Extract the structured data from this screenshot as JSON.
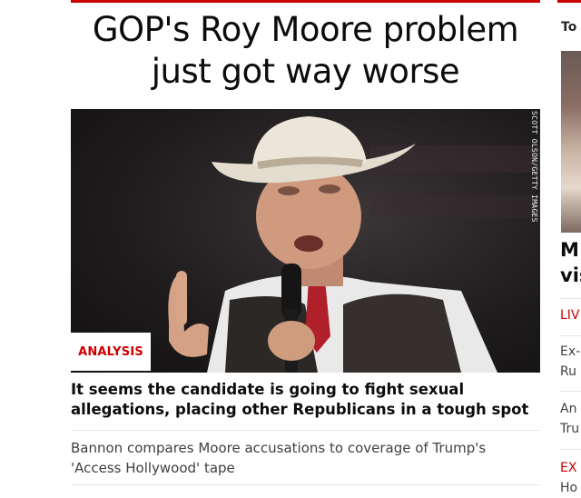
{
  "main": {
    "headline_line1": "GOP's Roy Moore problem",
    "headline_line2": "just got way worse",
    "photo_credit": "SCOTT OLSON/GETTY IMAGES",
    "badge": "ANALYSIS",
    "summary_line1": "It seems the candidate is going to fight sexual",
    "summary_line2": "allegations, placing other Republicans in a tough spot",
    "related_line1": "Bannon compares Moore accusations to coverage of Trump's",
    "related_line2": "'Access Hollywood' tape"
  },
  "side": {
    "header": "To",
    "title_line1": "M",
    "title_line2": "vis",
    "items": [
      {
        "line1": "LIV",
        "line2": ""
      },
      {
        "line1": "Ex-",
        "line2": "Ru"
      },
      {
        "line1": "An",
        "line2": "Tru"
      },
      {
        "line1": "EX",
        "line2": "Ho"
      }
    ]
  },
  "colors": {
    "accent": "#cc0000",
    "headline": "#0c0c0c",
    "body_text": "#404040"
  }
}
